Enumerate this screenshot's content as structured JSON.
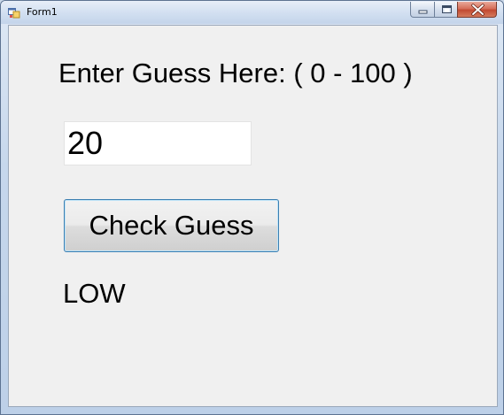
{
  "window": {
    "title": "Form1",
    "icons": {
      "app": "form-app-icon",
      "minimize": "minimize-icon",
      "maximize": "maximize-icon",
      "close": "close-icon"
    }
  },
  "form": {
    "prompt_label": "Enter Guess Here: ( 0 - 100 )",
    "guess_value": "20",
    "check_button_label": "Check Guess",
    "result_label": "LOW"
  },
  "colors": {
    "client_background": "#f0f0f0",
    "button_border": "#3c7fb1",
    "close_button": "#c24a31"
  }
}
